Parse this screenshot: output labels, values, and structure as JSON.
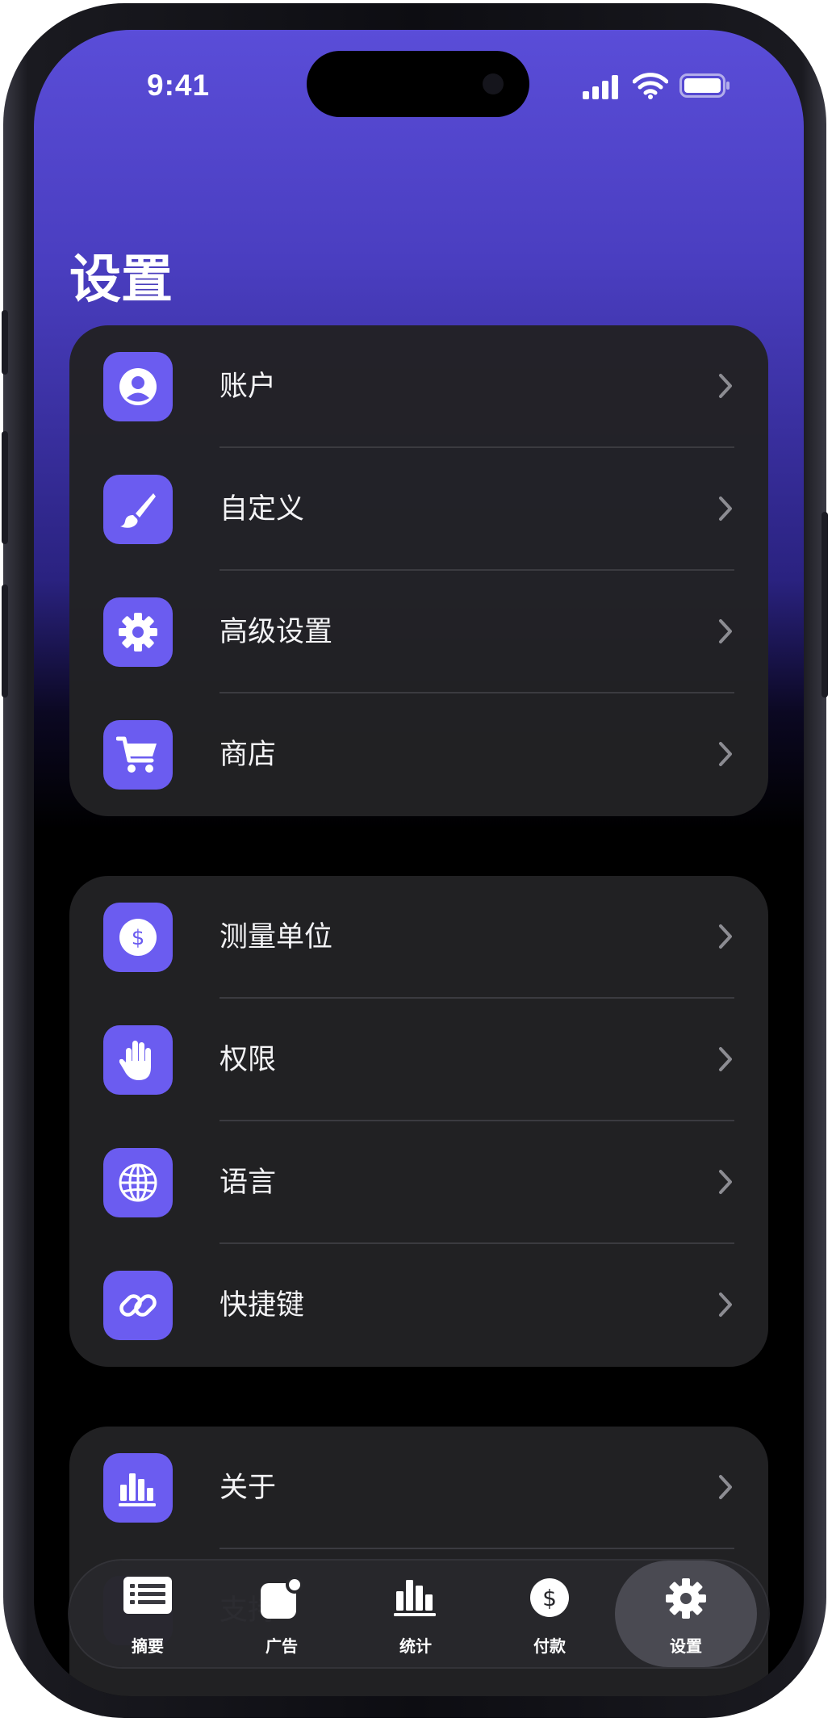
{
  "status": {
    "time": "9:41"
  },
  "page": {
    "title": "设置"
  },
  "groups": [
    {
      "items": [
        {
          "label": "账户",
          "icon": "person-circle-icon"
        },
        {
          "label": "自定义",
          "icon": "paintbrush-icon"
        },
        {
          "label": "高级设置",
          "icon": "gear-icon"
        },
        {
          "label": "商店",
          "icon": "cart-icon"
        }
      ]
    },
    {
      "items": [
        {
          "label": "测量单位",
          "icon": "dollar-circle-icon"
        },
        {
          "label": "权限",
          "icon": "hand-icon"
        },
        {
          "label": "语言",
          "icon": "globe-icon"
        },
        {
          "label": "快捷键",
          "icon": "link-icon"
        }
      ]
    },
    {
      "items": [
        {
          "label": "关于",
          "icon": "bar-chart-icon"
        },
        {
          "label": "支持",
          "icon": "support-icon"
        }
      ]
    }
  ],
  "tabs": [
    {
      "label": "摘要",
      "icon": "list-icon",
      "active": false
    },
    {
      "label": "广告",
      "icon": "app-badge-icon",
      "active": false
    },
    {
      "label": "统计",
      "icon": "bar-chart-icon",
      "active": false
    },
    {
      "label": "付款",
      "icon": "dollar-circle-icon",
      "active": false
    },
    {
      "label": "设置",
      "icon": "gear-icon",
      "active": true
    }
  ],
  "colors": {
    "accent": "#6b5cf0",
    "header_gradient_top": "#5a4dd8",
    "card": "#222224"
  }
}
